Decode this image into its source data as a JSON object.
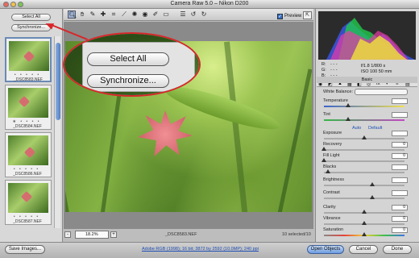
{
  "window": {
    "title": "Camera Raw 5.0  –  Nikon D200"
  },
  "filmstrip": {
    "select_all_label": "Select All",
    "synchronize_label": "Synchronize...",
    "thumbnails": [
      {
        "filename": "_DSC8583.NEF",
        "rating": "• • • • •",
        "selected": true
      },
      {
        "filename": "_DSC8584.NEF",
        "rating": "★ • • • •",
        "selected": false
      },
      {
        "filename": "_DSC8586.NEF",
        "rating": "• • • • •",
        "selected": false
      },
      {
        "filename": "_DSC8587.NEF",
        "rating": "• • • • •",
        "selected": false
      }
    ]
  },
  "toolbar": {
    "tools": [
      "zoom-icon",
      "hand-icon",
      "white-balance-icon",
      "color-sampler-icon",
      "crop-icon",
      "straighten-icon",
      "retouch-icon",
      "red-eye-icon",
      "adjustment-brush-icon",
      "graduated-filter-icon",
      "preferences-icon",
      "rotate-left-icon",
      "rotate-right-icon"
    ],
    "preview_label": "Preview",
    "preview_checked": true
  },
  "callout": {
    "select_all_label": "Select All",
    "synchronize_label": "Synchronize..."
  },
  "image_footer": {
    "zoom_value": "18.2%",
    "zoom_minus": "-",
    "zoom_plus": "+",
    "filename": "_DSC8583.NEF",
    "selected_count": "10 selected/10"
  },
  "histogram": {
    "readout_r": "R:",
    "readout_g": "G:",
    "readout_b": "B:",
    "r_value": "- - -",
    "g_value": "- - -",
    "b_value": "- - -",
    "aperture_shutter": "f/1.8   1/800 s",
    "iso_focal": "ISO 100   50 mm"
  },
  "panel": {
    "section_title": "Basic",
    "white_balance_label": "White Balance:",
    "auto_label": "Auto",
    "default_label": "Default",
    "controls": [
      {
        "label": "Temperature",
        "value": "",
        "level": 0.3
      },
      {
        "label": "Tint",
        "value": "",
        "level": 0.3
      },
      {
        "label": "Exposure",
        "value": "",
        "level": 0.5
      },
      {
        "label": "Recovery",
        "value": "0",
        "level": 0.0
      },
      {
        "label": "Fill Light",
        "value": "0",
        "level": 0.0
      },
      {
        "label": "Blacks",
        "value": "",
        "level": 0.05
      },
      {
        "label": "Brightness",
        "value": "",
        "level": 0.6
      },
      {
        "label": "Contrast",
        "value": "",
        "level": 0.6
      },
      {
        "label": "Clarity",
        "value": "0",
        "level": 0.5
      },
      {
        "label": "Vibrance",
        "value": "0",
        "level": 0.5
      },
      {
        "label": "Saturation",
        "value": "0",
        "level": 0.5
      }
    ]
  },
  "bottom": {
    "save_label": "Save Images...",
    "workflow_label": "Adobe RGB (1998); 16 bit; 3872 by 2592 (10.0MP); 240 ppi",
    "open_label": "Open Objects",
    "cancel_label": "Cancel",
    "done_label": "Done"
  },
  "colors": {
    "callout_red": "#d8262a",
    "link_blue": "#1f4fb5",
    "primary_button": "#6b9be0"
  }
}
